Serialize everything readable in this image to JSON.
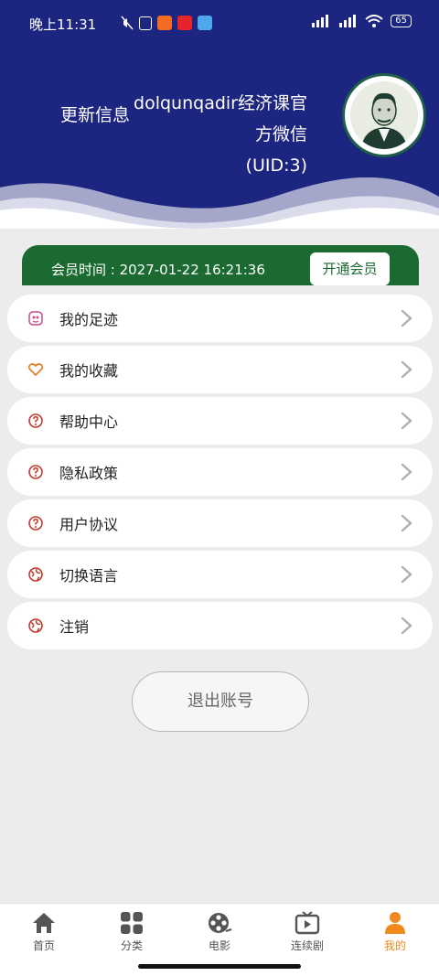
{
  "status_bar": {
    "time": "晚上11:31",
    "battery": "65"
  },
  "header": {
    "update_label": "更新信息",
    "user_name": "dolqunqadir经济课官方微信",
    "uid": "(UID:3)"
  },
  "member": {
    "time_text": "会员时间 : 2027-01-22 16:21:36",
    "button_label": "开通会员"
  },
  "menu": [
    {
      "label": "我的足迹",
      "icon": "footprint-icon",
      "color": "#c94a8a"
    },
    {
      "label": "我的收藏",
      "icon": "heart-icon",
      "color": "#e07a1f"
    },
    {
      "label": "帮助中心",
      "icon": "help-icon",
      "color": "#c0392b"
    },
    {
      "label": "隐私政策",
      "icon": "help-icon",
      "color": "#c0392b"
    },
    {
      "label": "用户协议",
      "icon": "help-icon",
      "color": "#c0392b"
    },
    {
      "label": "切换语言",
      "icon": "globe-icon",
      "color": "#c0392b"
    },
    {
      "label": "注销",
      "icon": "globe-icon",
      "color": "#c0392b"
    }
  ],
  "logout_label": "退出账号",
  "tabs": [
    {
      "label": "首页",
      "icon": "home-icon"
    },
    {
      "label": "分类",
      "icon": "grid-icon"
    },
    {
      "label": "电影",
      "icon": "film-reel-icon"
    },
    {
      "label": "连续剧",
      "icon": "tv-play-icon"
    },
    {
      "label": "我的",
      "icon": "person-icon",
      "active": true
    }
  ],
  "colors": {
    "header_blue": "#1c2580",
    "member_green": "#1a6a32",
    "active_tab": "#f08a1c"
  }
}
